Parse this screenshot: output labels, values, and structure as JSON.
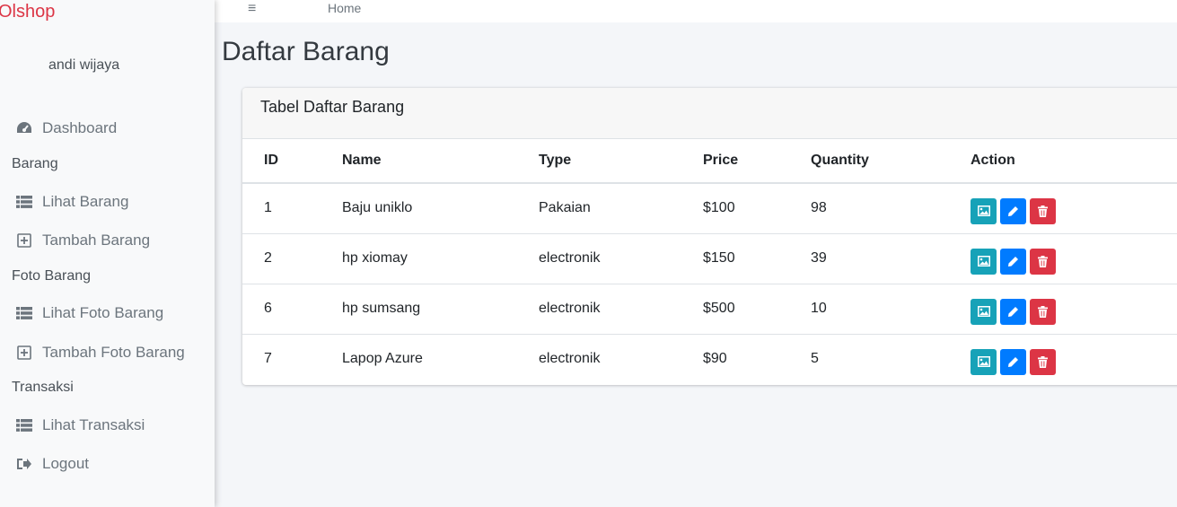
{
  "brand": "Olshop",
  "user": {
    "name": "andi wijaya"
  },
  "sidebar": {
    "dashboard": "Dashboard",
    "header_barang": "Barang",
    "lihat_barang": "Lihat Barang",
    "tambah_barang": "Tambah Barang",
    "header_foto": "Foto Barang",
    "lihat_foto": "Lihat Foto Barang",
    "tambah_foto": "Tambah Foto Barang",
    "header_transaksi": "Transaksi",
    "lihat_transaksi": "Lihat Transaksi",
    "logout": "Logout"
  },
  "topbar": {
    "menu_icon": "≡",
    "home": "Home"
  },
  "page": {
    "title": "Daftar Barang"
  },
  "card": {
    "title": "Tabel Daftar Barang",
    "columns": [
      "ID",
      "Name",
      "Type",
      "Price",
      "Quantity",
      "Action"
    ],
    "rows": [
      {
        "id": "1",
        "name": "Baju uniklo",
        "type": "Pakaian",
        "price": "$100",
        "quantity": "98"
      },
      {
        "id": "2",
        "name": "hp xiomay",
        "type": "electronik",
        "price": "$150",
        "quantity": "39"
      },
      {
        "id": "6",
        "name": "hp sumsang",
        "type": "electronik",
        "price": "$500",
        "quantity": "10"
      },
      {
        "id": "7",
        "name": "Lapop Azure",
        "type": "electronik",
        "price": "$90",
        "quantity": "5"
      }
    ]
  },
  "colors": {
    "brand": "#dc3545",
    "info": "#17a2b8",
    "primary": "#007bff",
    "danger": "#dc3545"
  },
  "icons": {
    "dashboard": "tachometer-icon",
    "list": "list-icon",
    "add": "plus-square-icon",
    "logout": "sign-out-icon",
    "image": "image-icon",
    "edit": "pencil-icon",
    "delete": "trash-icon"
  }
}
